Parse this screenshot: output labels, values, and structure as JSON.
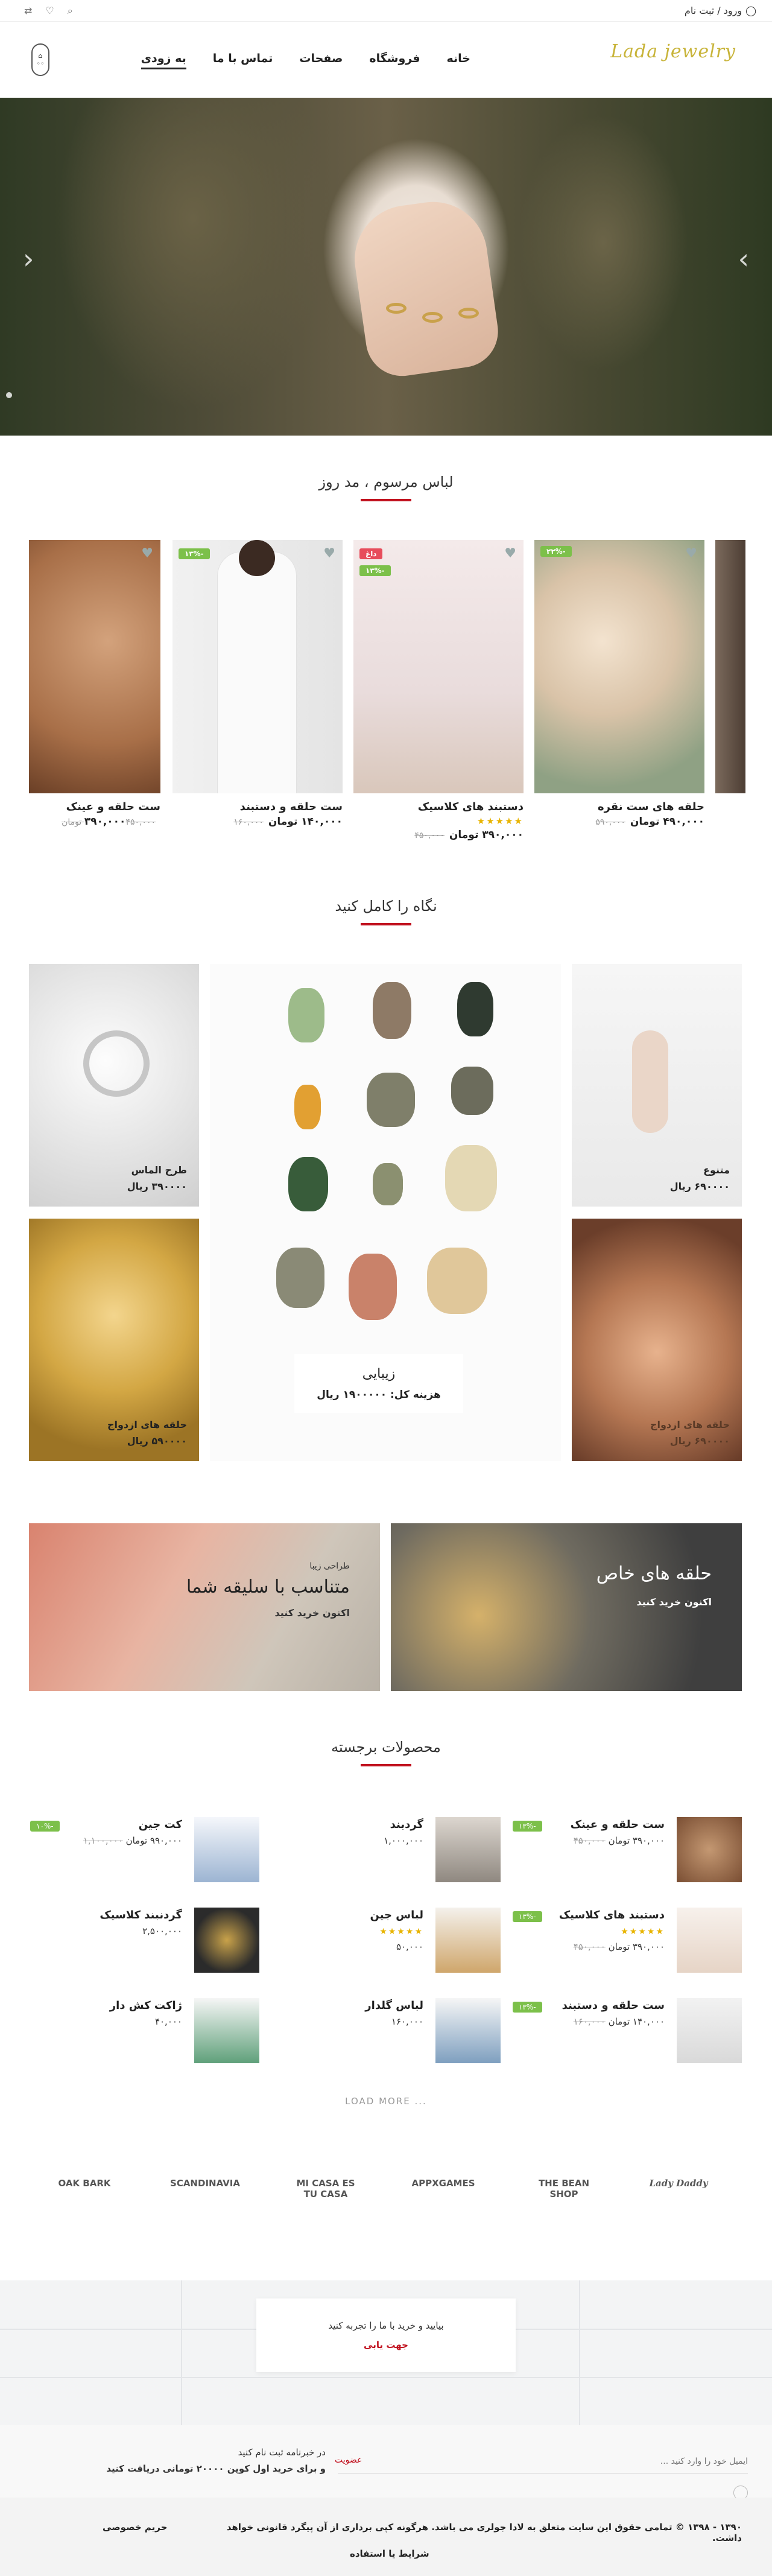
{
  "topbar": {
    "login": "ورود / ثبت نام"
  },
  "header": {
    "logo": "Lada jewelry",
    "nav": [
      "خانه",
      "فروشگاه",
      "صفحات",
      "تماس با ما",
      "به زودی"
    ]
  },
  "sections": {
    "products_title": "لباس مرسوم ، مد روز",
    "look_title": "نگاه را کامل کنید",
    "featured_title": "محصولات برجسته",
    "load_more": "... LOAD MORE"
  },
  "carousel": [
    {
      "name": "حلقه های ست نقره",
      "badge": "-۲۲%",
      "badge_color": "#7cc04a",
      "old": "۵۹۰,۰۰۰",
      "new": "۴۹۰,۰۰۰ تومان",
      "stars": false
    },
    {
      "name": "دستبند های کلاسیک",
      "badge": "داغ",
      "badge_color": "#e74c5b",
      "badge2": "-۱۳%",
      "old": "۴۵۰,۰۰۰",
      "new": "۳۹۰,۰۰۰ تومان",
      "stars": true
    },
    {
      "name": "ست حلقه و دستبند",
      "badge": "-۱۳%",
      "badge_color": "#7cc04a",
      "old": "۱۶۰,۰۰۰",
      "new": "۱۴۰,۰۰۰ تومان",
      "stars": false
    },
    {
      "name": "ست حلقه و عینک",
      "badge": "",
      "badge_color": "",
      "old": "۴۵۰,۰۰۰ تومان",
      "new": "۳۹۰,۰۰۰",
      "stars": false
    }
  ],
  "gallery": {
    "diamond": {
      "title": "طرح الماس",
      "price": "۳۹۰۰۰۰ ریال"
    },
    "wedding": {
      "title": "حلقه های ازدواج",
      "price": "۵۹۰۰۰۰ ریال"
    },
    "variety": {
      "title": "متنوع",
      "price": "۶۹۰۰۰۰ ریال"
    },
    "hand_ring": {
      "title": "حلقه های ازدواج",
      "price": "۶۹۰۰۰۰ ریال"
    },
    "center": {
      "title": "زیبایی",
      "price": "هزینه کل: ۱۹۰۰۰۰۰ ریال"
    }
  },
  "banners": {
    "left": {
      "small": "طراحی زیبا",
      "big": "متناسب با سلیقه شما",
      "cta": "اکنون خرید کنید"
    },
    "right": {
      "big": "حلقه های خاص",
      "cta": "اکنون خرید کنید"
    }
  },
  "featured": [
    {
      "name": "ست حلقه و عینک",
      "old": "۴۵۰,۰۰۰",
      "new": "۳۹۰,۰۰۰ تومان",
      "badge": "-۱۳%",
      "stars": false
    },
    {
      "name": "گردبند",
      "old": "",
      "new": "۱,۰۰۰,۰۰۰",
      "badge": "",
      "stars": false
    },
    {
      "name": "کت جین",
      "old": "۱,۱۰۰,۰۰۰",
      "new": "۹۹۰,۰۰۰ تومان",
      "badge": "-۱۰%",
      "stars": false
    },
    {
      "name": "دستبند های کلاسیک",
      "old": "۴۵۰,۰۰۰",
      "new": "۳۹۰,۰۰۰ تومان",
      "badge": "-۱۳%",
      "stars": true
    },
    {
      "name": "لباس جین",
      "old": "",
      "new": "۵۰,۰۰۰",
      "badge": "",
      "stars": true
    },
    {
      "name": "گردنبند کلاسیک",
      "old": "",
      "new": "۲,۵۰۰,۰۰۰",
      "badge": "",
      "stars": false
    },
    {
      "name": "ست حلقه و دستبند",
      "old": "۱۶۰,۰۰۰",
      "new": "۱۴۰,۰۰۰ تومان",
      "badge": "-۱۳%",
      "stars": false
    },
    {
      "name": "لباس گلدار",
      "old": "",
      "new": "۱۶۰,۰۰۰",
      "badge": "",
      "stars": false
    },
    {
      "name": "ژاکت کش دار",
      "old": "",
      "new": "۴۰,۰۰۰",
      "badge": "",
      "stars": false
    }
  ],
  "brands": [
    "OAK BARK",
    "SCANDINAVIA",
    "MI CASA ES TU CASA",
    "APPXGAMES",
    "THE BEAN SHOP",
    "Lady Daddy"
  ],
  "footer": {
    "map_text": "بیایید و خرید با ما را تجربه کنید",
    "map_link": "جهت یابی",
    "newsletter_title": "در خبرنامه ثبت نام کنید",
    "newsletter_sub": "و برای خرید اول کوپن ۲۰۰۰۰ تومانی دریافت کنید",
    "email_placeholder": "ایمیل خود را وارد کنید ...",
    "subscribe": "عضویت",
    "copyright": "۱۳۹۰ - ۱۳۹۸ © تمامی حقوق این سایت متعلق به لادا جولری می باشد. هرگونه کپی برداری از آن پیگرد قانونی خواهد داشت.",
    "privacy": "حریم خصوصی",
    "terms": "شرایط یا استفاده"
  }
}
